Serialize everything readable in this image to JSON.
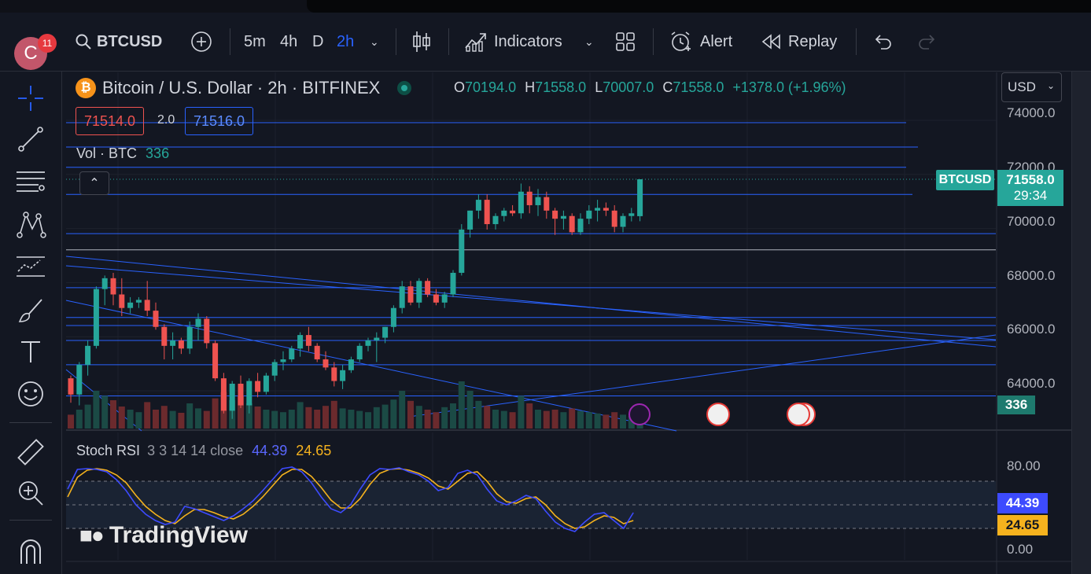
{
  "toolbar": {
    "avatar_letter": "C",
    "notification_count": "11",
    "symbol": "BTCUSD",
    "intervals": [
      "5m",
      "4h",
      "D",
      "2h"
    ],
    "active_interval": "2h",
    "indicators_label": "Indicators",
    "alert_label": "Alert",
    "replay_label": "Replay"
  },
  "legend": {
    "title": "Bitcoin / U.S. Dollar · 2h · BITFINEX",
    "open_label": "O",
    "open": "70194.0",
    "high_label": "H",
    "high": "71558.0",
    "low_label": "L",
    "low": "70007.0",
    "close_label": "C",
    "close": "71558.0",
    "change": "+1378.0 (+1.96%)",
    "sell_price": "71514.0",
    "spread": "2.0",
    "buy_price": "71516.0",
    "vol_label": "Vol · BTC",
    "vol_value": "336"
  },
  "currency": "USD",
  "price_axis": {
    "ticks": [
      "74000.0",
      "72000.0",
      "70000.0",
      "68000.0",
      "66000.0",
      "64000.0"
    ],
    "symbol_tag": "BTCUSD",
    "last_price": "71558.0",
    "countdown": "29:34",
    "volume_tag": "336"
  },
  "stoch_rsi": {
    "label": "Stoch RSI",
    "params": "3 3 14 14 close",
    "k_value": "44.39",
    "d_value": "24.65",
    "axis_ticks": [
      "80.00",
      "0.00"
    ]
  },
  "watermark": "TradingView",
  "colors": {
    "up": "#26a69a",
    "down": "#ef5350",
    "accent": "#2962ff",
    "k_line": "#3d4bff",
    "d_line": "#f5b21e",
    "background": "#131722"
  },
  "chart_data": {
    "type": "candlestick",
    "title": "Bitcoin / U.S. Dollar · 2h · BITFINEX",
    "ylim": [
      63000,
      74600
    ],
    "y_ticks": [
      64000,
      66000,
      68000,
      70000,
      72000,
      74000
    ],
    "grid": true,
    "candles": [
      [
        64200,
        64300,
        63300,
        63600
      ],
      [
        63600,
        64800,
        63200,
        64700
      ],
      [
        64700,
        65600,
        64300,
        65400
      ],
      [
        65400,
        67600,
        65300,
        67500
      ],
      [
        67500,
        68000,
        66900,
        67900
      ],
      [
        67900,
        68100,
        66900,
        67300
      ],
      [
        67300,
        67900,
        66500,
        66800
      ],
      [
        66800,
        67200,
        66600,
        67000
      ],
      [
        67000,
        67200,
        66800,
        67100
      ],
      [
        67100,
        67800,
        66500,
        66700
      ],
      [
        66700,
        67000,
        66000,
        66100
      ],
      [
        66100,
        66200,
        64900,
        65400
      ],
      [
        65400,
        65900,
        64900,
        65600
      ],
      [
        65600,
        65700,
        65100,
        65300
      ],
      [
        65300,
        66300,
        65100,
        66100
      ],
      [
        66100,
        66600,
        65600,
        66400
      ],
      [
        66400,
        66500,
        65300,
        65500
      ],
      [
        65500,
        65600,
        64100,
        64200
      ],
      [
        64200,
        64400,
        62900,
        63000
      ],
      [
        63000,
        64100,
        62700,
        64000
      ],
      [
        64000,
        64300,
        63100,
        63200
      ],
      [
        63200,
        64200,
        62900,
        64100
      ],
      [
        64100,
        64400,
        63500,
        63700
      ],
      [
        63700,
        64400,
        63600,
        64300
      ],
      [
        64300,
        64900,
        64100,
        64800
      ],
      [
        64800,
        65200,
        64500,
        64900
      ],
      [
        64900,
        65400,
        64800,
        65300
      ],
      [
        65300,
        65900,
        65000,
        65800
      ],
      [
        65800,
        66100,
        65200,
        65400
      ],
      [
        65400,
        65500,
        64800,
        64900
      ],
      [
        64900,
        65200,
        64500,
        64600
      ],
      [
        64600,
        64800,
        63900,
        64100
      ],
      [
        64100,
        64700,
        63800,
        64500
      ],
      [
        64500,
        65000,
        64400,
        64900
      ],
      [
        64900,
        65500,
        64800,
        65400
      ],
      [
        65400,
        65700,
        65200,
        65600
      ],
      [
        65600,
        65900,
        64800,
        65700
      ],
      [
        65700,
        66100,
        65500,
        66100
      ],
      [
        66100,
        66900,
        65900,
        66800
      ],
      [
        66800,
        67800,
        66600,
        67600
      ],
      [
        67600,
        67800,
        66900,
        67000
      ],
      [
        67000,
        67900,
        66800,
        67800
      ],
      [
        67800,
        67900,
        67200,
        67300
      ],
      [
        67300,
        67500,
        66900,
        67000
      ],
      [
        67000,
        67400,
        66800,
        67300
      ],
      [
        67300,
        68200,
        67200,
        68100
      ],
      [
        68100,
        69900,
        68000,
        69700
      ],
      [
        69700,
        70400,
        69400,
        70400
      ],
      [
        70400,
        71000,
        70100,
        70800
      ],
      [
        70800,
        71000,
        69700,
        69900
      ],
      [
        69900,
        70300,
        69700,
        70200
      ],
      [
        70200,
        70500,
        70000,
        70400
      ],
      [
        70400,
        70600,
        70200,
        70300
      ],
      [
        70300,
        71400,
        70100,
        71100
      ],
      [
        71100,
        71300,
        70300,
        70600
      ],
      [
        70600,
        71200,
        70200,
        70900
      ],
      [
        70900,
        71100,
        70100,
        70400
      ],
      [
        70400,
        70500,
        69500,
        70100
      ],
      [
        70100,
        70400,
        69700,
        70200
      ],
      [
        70200,
        70300,
        69500,
        69600
      ],
      [
        69600,
        70300,
        69500,
        70100
      ],
      [
        70100,
        70600,
        69900,
        70400
      ],
      [
        70400,
        70800,
        70000,
        70500
      ],
      [
        70500,
        70700,
        70200,
        70400
      ],
      [
        70400,
        70600,
        69600,
        69800
      ],
      [
        69800,
        70300,
        69600,
        70200
      ],
      [
        70200,
        70500,
        70000,
        70300
      ],
      [
        70194,
        71558,
        70007,
        71558
      ]
    ],
    "volume": [
      22,
      30,
      38,
      60,
      52,
      45,
      35,
      30,
      26,
      42,
      30,
      36,
      28,
      25,
      40,
      32,
      28,
      48,
      58,
      45,
      52,
      40,
      35,
      30,
      28,
      26,
      30,
      42,
      34,
      30,
      36,
      44,
      32,
      30,
      28,
      26,
      34,
      38,
      46,
      60,
      44,
      36,
      30,
      26,
      34,
      40,
      75,
      60,
      44,
      36,
      30,
      28,
      26,
      52,
      40,
      30,
      28,
      30,
      26,
      32,
      28,
      26,
      24,
      22,
      26,
      22,
      20,
      24
    ],
    "horizontal_levels": [
      73650,
      72750,
      72000,
      71000,
      69550,
      68950,
      67550,
      66450,
      66150,
      65600,
      64700,
      63550
    ],
    "stoch_rsi": {
      "k": [
        70,
        95,
        96,
        95,
        92,
        82,
        68,
        50,
        38,
        30,
        25,
        28,
        48,
        45,
        40,
        35,
        30,
        36,
        45,
        55,
        68,
        82,
        96,
        98,
        92,
        78,
        60,
        45,
        40,
        50,
        70,
        88,
        96,
        95,
        97,
        92,
        88,
        80,
        68,
        72,
        90,
        94,
        88,
        70,
        55,
        50,
        55,
        62,
        58,
        42,
        28,
        20,
        16,
        28,
        38,
        40,
        30,
        20,
        40
      ],
      "d": [
        60,
        85,
        94,
        96,
        94,
        88,
        78,
        62,
        48,
        38,
        30,
        26,
        36,
        44,
        44,
        40,
        35,
        32,
        38,
        48,
        60,
        74,
        88,
        95,
        95,
        86,
        72,
        56,
        46,
        46,
        58,
        76,
        90,
        95,
        96,
        94,
        90,
        84,
        74,
        70,
        80,
        90,
        92,
        80,
        64,
        54,
        52,
        58,
        60,
        50,
        36,
        26,
        20,
        22,
        30,
        36,
        34,
        26,
        30
      ]
    }
  }
}
